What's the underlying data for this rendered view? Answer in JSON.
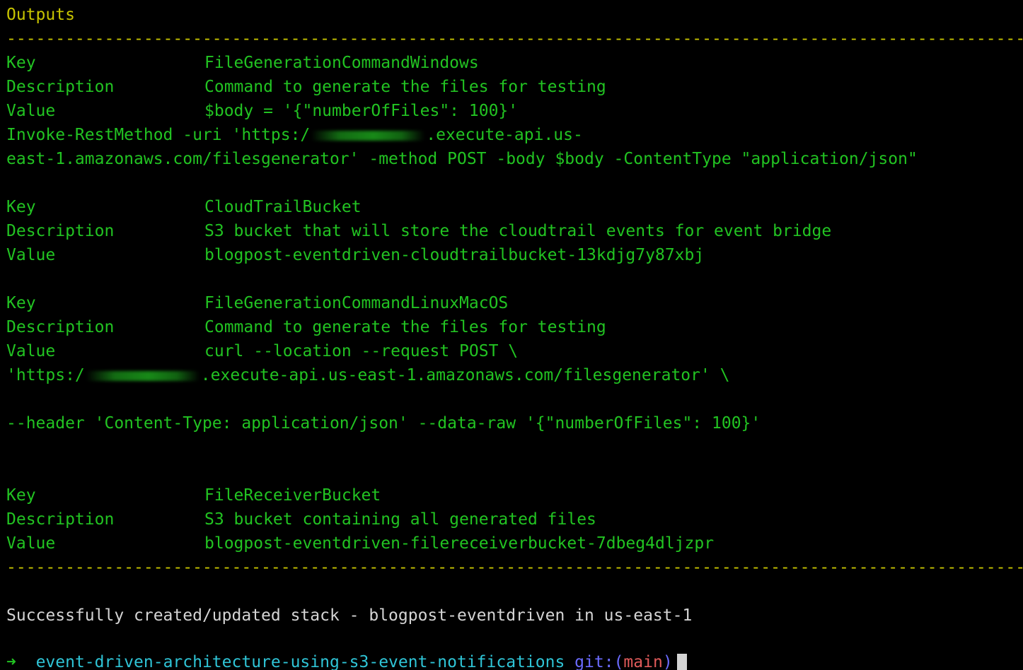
{
  "header": {
    "title": "Outputs"
  },
  "dashes": "--------------------------------------------------------------------------------------------------------------------------------------------------------",
  "outputs": [
    {
      "key_label": "Key",
      "key": "FileGenerationCommandWindows",
      "description_label": "Description",
      "description": "Command to generate the files for testing",
      "value_label": "Value",
      "value": "$body = '{\"numberOfFiles\": 100}'",
      "continuation": [
        {
          "before": "Invoke-RestMethod -uri 'https:/",
          "after": ".execute-api.us-"
        },
        {
          "before": "east-1.amazonaws.com/filesgenerator' -method POST -body $body -ContentType \"application/json\""
        }
      ]
    },
    {
      "key_label": "Key",
      "key": "CloudTrailBucket",
      "description_label": "Description",
      "description": "S3 bucket that will store the cloudtrail events for event bridge",
      "value_label": "Value",
      "value": "blogpost-eventdriven-cloudtrailbucket-13kdjg7y87xbj"
    },
    {
      "key_label": "Key",
      "key": "FileGenerationCommandLinuxMacOS",
      "description_label": "Description",
      "description": "Command to generate the files for testing",
      "value_label": "Value",
      "value": "curl --location --request POST \\",
      "continuation": [
        {
          "before": "'https:/",
          "after": ".execute-api.us-east-1.amazonaws.com/filesgenerator' \\"
        },
        {
          "before": "--header 'Content-Type: application/json' --data-raw '{\"numberOfFiles\": 100}'"
        }
      ]
    },
    {
      "key_label": "Key",
      "key": "FileReceiverBucket",
      "description_label": "Description",
      "description": "S3 bucket containing all generated files",
      "value_label": "Value",
      "value": "blogpost-eventdriven-filereceiverbucket-7dbeg4dljzpr"
    }
  ],
  "status_message": "Successfully created/updated stack - blogpost-eventdriven in us-east-1",
  "prompt": {
    "arrow": "➜",
    "directory": "event-driven-architecture-using-s3-event-notifications",
    "git_label": "git:",
    "open_paren": "(",
    "branch": "main",
    "close_paren": ")"
  },
  "colors": {
    "background": "#000000",
    "green": "#22c322",
    "yellow": "#c7c400",
    "white": "#d4d4d4",
    "cyan": "#2fc4d6",
    "blue": "#6b6bff",
    "red": "#e05a5a"
  }
}
